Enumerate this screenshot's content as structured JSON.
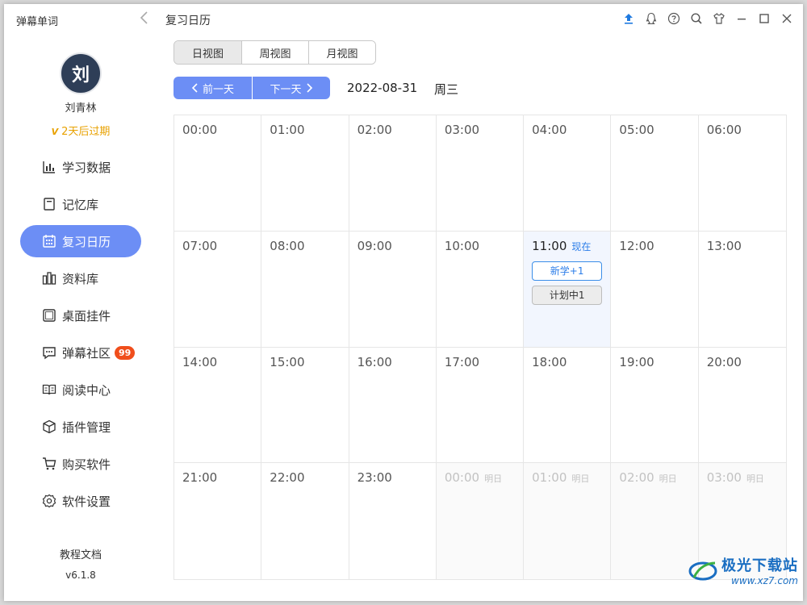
{
  "app": {
    "name": "弹幕单词"
  },
  "user": {
    "avatar_char": "刘",
    "name": "刘青林",
    "expire_text": "2天后过期"
  },
  "nav": [
    {
      "label": "学习数据",
      "icon": "bar-chart-icon"
    },
    {
      "label": "记忆库",
      "icon": "memory-book-icon"
    },
    {
      "label": "复习日历",
      "icon": "calendar-icon",
      "active": true
    },
    {
      "label": "资料库",
      "icon": "library-icon"
    },
    {
      "label": "桌面挂件",
      "icon": "widget-icon"
    },
    {
      "label": "弹幕社区",
      "icon": "chat-icon",
      "badge": "99"
    },
    {
      "label": "阅读中心",
      "icon": "book-open-icon"
    },
    {
      "label": "插件管理",
      "icon": "plugin-icon"
    },
    {
      "label": "购买软件",
      "icon": "cart-icon"
    },
    {
      "label": "软件设置",
      "icon": "gear-icon"
    }
  ],
  "footer": {
    "docs": "教程文档",
    "version": "v6.1.8"
  },
  "header": {
    "title": "复习日历"
  },
  "view_tabs": [
    "日视图",
    "周视图",
    "月视图"
  ],
  "day_nav": {
    "prev": "前一天",
    "next": "下一天"
  },
  "date": "2022-08-31",
  "weekday": "周三",
  "slots": [
    {
      "time": "00:00"
    },
    {
      "time": "01:00"
    },
    {
      "time": "02:00"
    },
    {
      "time": "03:00"
    },
    {
      "time": "04:00"
    },
    {
      "time": "05:00"
    },
    {
      "time": "06:00"
    },
    {
      "time": "07:00"
    },
    {
      "time": "08:00"
    },
    {
      "time": "09:00"
    },
    {
      "time": "10:00"
    },
    {
      "time": "11:00",
      "tag": "现在",
      "state": "now",
      "events": [
        {
          "label": "新学+1",
          "style": "blue"
        },
        {
          "label": "计划中1",
          "style": "grey"
        }
      ]
    },
    {
      "time": "12:00"
    },
    {
      "time": "13:00"
    },
    {
      "time": "14:00"
    },
    {
      "time": "15:00"
    },
    {
      "time": "16:00"
    },
    {
      "time": "17:00"
    },
    {
      "time": "18:00"
    },
    {
      "time": "19:00"
    },
    {
      "time": "20:00"
    },
    {
      "time": "21:00"
    },
    {
      "time": "22:00"
    },
    {
      "time": "23:00"
    },
    {
      "time": "00:00",
      "tag": "明日",
      "state": "next"
    },
    {
      "time": "01:00",
      "tag": "明日",
      "state": "next"
    },
    {
      "time": "02:00",
      "tag": "明日",
      "state": "next"
    },
    {
      "time": "03:00",
      "tag": "明日",
      "state": "next"
    }
  ],
  "watermark": {
    "title": "极光下载站",
    "url": "www.xz7.com"
  },
  "colors": {
    "accent": "#6c8ef5",
    "now_bg": "#f2f6fe",
    "badge": "#f04e1c",
    "expire": "#e8a100"
  }
}
